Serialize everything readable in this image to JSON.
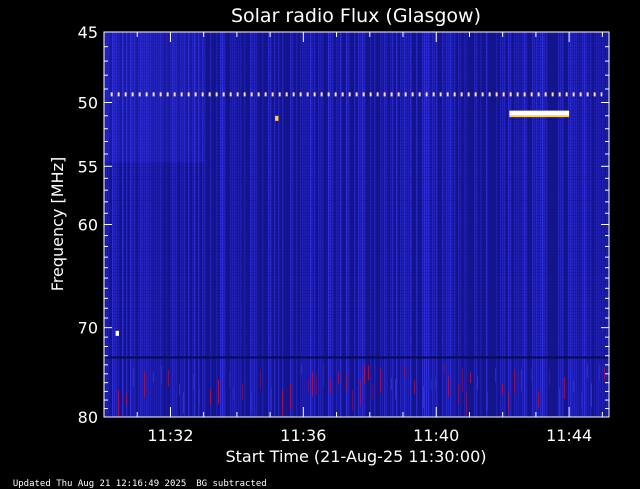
{
  "chart_data": {
    "type": "heatmap",
    "title": "Solar radio Flux (Glasgow)",
    "xlabel": "Start Time (21-Aug-25 11:30:00)",
    "ylabel": "Frequency [MHz]",
    "x_unit": "minutes since 11:30:00",
    "xlim": [
      0,
      15.2
    ],
    "x_ticks": [
      {
        "value": 2,
        "label": "11:32"
      },
      {
        "value": 6,
        "label": "11:36"
      },
      {
        "value": 10,
        "label": "11:40"
      },
      {
        "value": 14,
        "label": "11:44"
      }
    ],
    "ylim": [
      45,
      80
    ],
    "y_scale": "log",
    "y_inverted": true,
    "y_ticks": [
      45,
      50,
      55,
      60,
      70,
      80
    ],
    "colormap": [
      "#14148c",
      "#2a2ad0",
      "#3b3bff",
      "#c0103a",
      "#ffffff",
      "#ffd040"
    ],
    "bright_features": [
      {
        "freq_mhz": 49.4,
        "x_start": 0.2,
        "x_end": 15.0,
        "kind": "dashed-line",
        "color": "#ffe0a0"
      },
      {
        "freq_mhz": 50.8,
        "x_start": 12.2,
        "x_end": 14.0,
        "kind": "bar",
        "color": "#ffffff"
      },
      {
        "freq_mhz": 51.2,
        "x_start": 5.15,
        "x_end": 5.25,
        "kind": "dot",
        "color": "#ffd040"
      },
      {
        "freq_mhz": 70.6,
        "x_start": 0.35,
        "x_end": 0.45,
        "kind": "dot",
        "color": "#ffffff"
      }
    ],
    "low_band_start_mhz": 73.2
  },
  "footer": {
    "updated": "Updated Thu Aug 21 12:16:49 2025",
    "note": "BG subtracted"
  }
}
